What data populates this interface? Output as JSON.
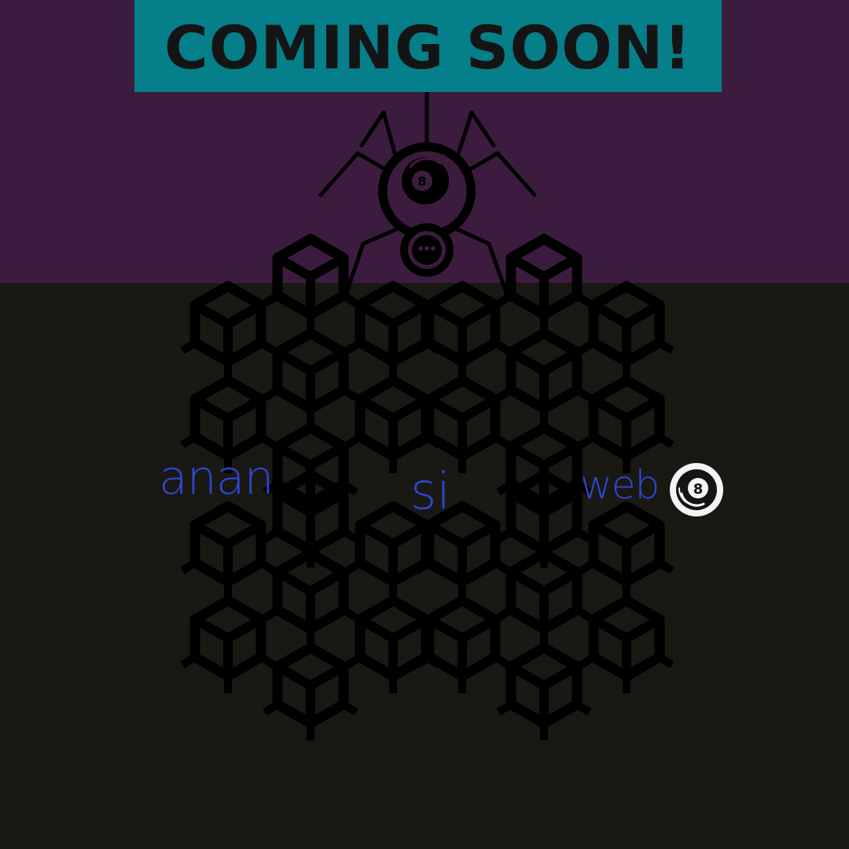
{
  "banner": {
    "title": "COMING SOON!"
  },
  "logo_words": {
    "word1": "anan",
    "word2": "si",
    "word3": "web"
  },
  "icons": {
    "spider": "spider-icon",
    "ball": "eight-ball-icon",
    "cube": "cube-network-icon"
  },
  "colors": {
    "top_background": "#3b1c3e",
    "bottom_background": "#1a1813",
    "banner_background": "#057f8a",
    "banner_text": "#141414",
    "logo_text": "#2c47cf",
    "shape_fill": "#000000"
  }
}
